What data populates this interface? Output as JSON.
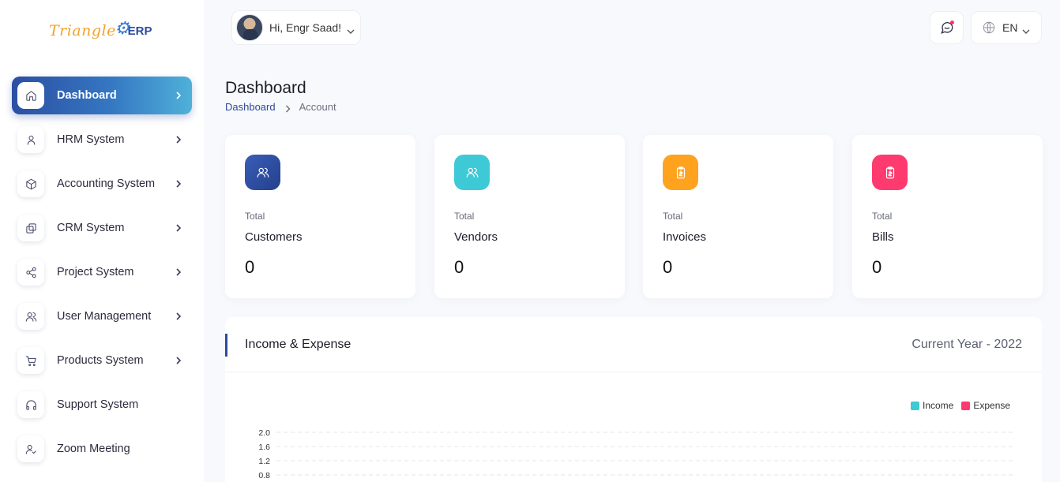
{
  "brand": {
    "name": "Triangle",
    "suffix": "ERP"
  },
  "header": {
    "greeting": "Hi, Engr Saad!",
    "language": "EN"
  },
  "sidebar": {
    "items": [
      {
        "label": "Dashboard",
        "icon": "home-icon",
        "active": true,
        "has_children": true
      },
      {
        "label": "HRM System",
        "icon": "user-icon",
        "has_children": true
      },
      {
        "label": "Accounting System",
        "icon": "box-icon",
        "has_children": true
      },
      {
        "label": "CRM System",
        "icon": "layers-icon",
        "has_children": true
      },
      {
        "label": "Project System",
        "icon": "share-icon",
        "has_children": true
      },
      {
        "label": "User Management",
        "icon": "users-icon",
        "has_children": true
      },
      {
        "label": "Products System",
        "icon": "cart-icon",
        "has_children": true
      },
      {
        "label": "Support System",
        "icon": "headphones-icon",
        "has_children": false
      },
      {
        "label": "Zoom Meeting",
        "icon": "user-check-icon",
        "has_children": false
      }
    ]
  },
  "page": {
    "title": "Dashboard",
    "breadcrumb": [
      "Dashboard",
      "Account"
    ]
  },
  "cards": [
    {
      "small": "Total",
      "name": "Customers",
      "value": "0",
      "color": "#2d4a9c",
      "icon": "users-icon"
    },
    {
      "small": "Total",
      "name": "Vendors",
      "value": "0",
      "color": "#3ec9d6",
      "icon": "users-icon"
    },
    {
      "small": "Total",
      "name": "Invoices",
      "value": "0",
      "color": "#ffa21d",
      "icon": "clipboard-icon"
    },
    {
      "small": "Total",
      "name": "Bills",
      "value": "0",
      "color": "#ff3a6e",
      "icon": "clipboard-icon"
    }
  ],
  "panel": {
    "title": "Income & Expense",
    "year_label": "Current Year - 2022"
  },
  "colors": {
    "income": "#3ec9d6",
    "expense": "#ff3a6e",
    "primary": "#2d4a9c"
  },
  "chart_data": {
    "type": "bar",
    "series": [
      {
        "name": "Income",
        "values": []
      },
      {
        "name": "Expense",
        "values": []
      }
    ],
    "y_ticks": [
      "2.0",
      "1.6",
      "1.2",
      "0.8"
    ],
    "ylim": [
      0,
      2.0
    ],
    "grid": true,
    "legend_position": "top-right"
  }
}
